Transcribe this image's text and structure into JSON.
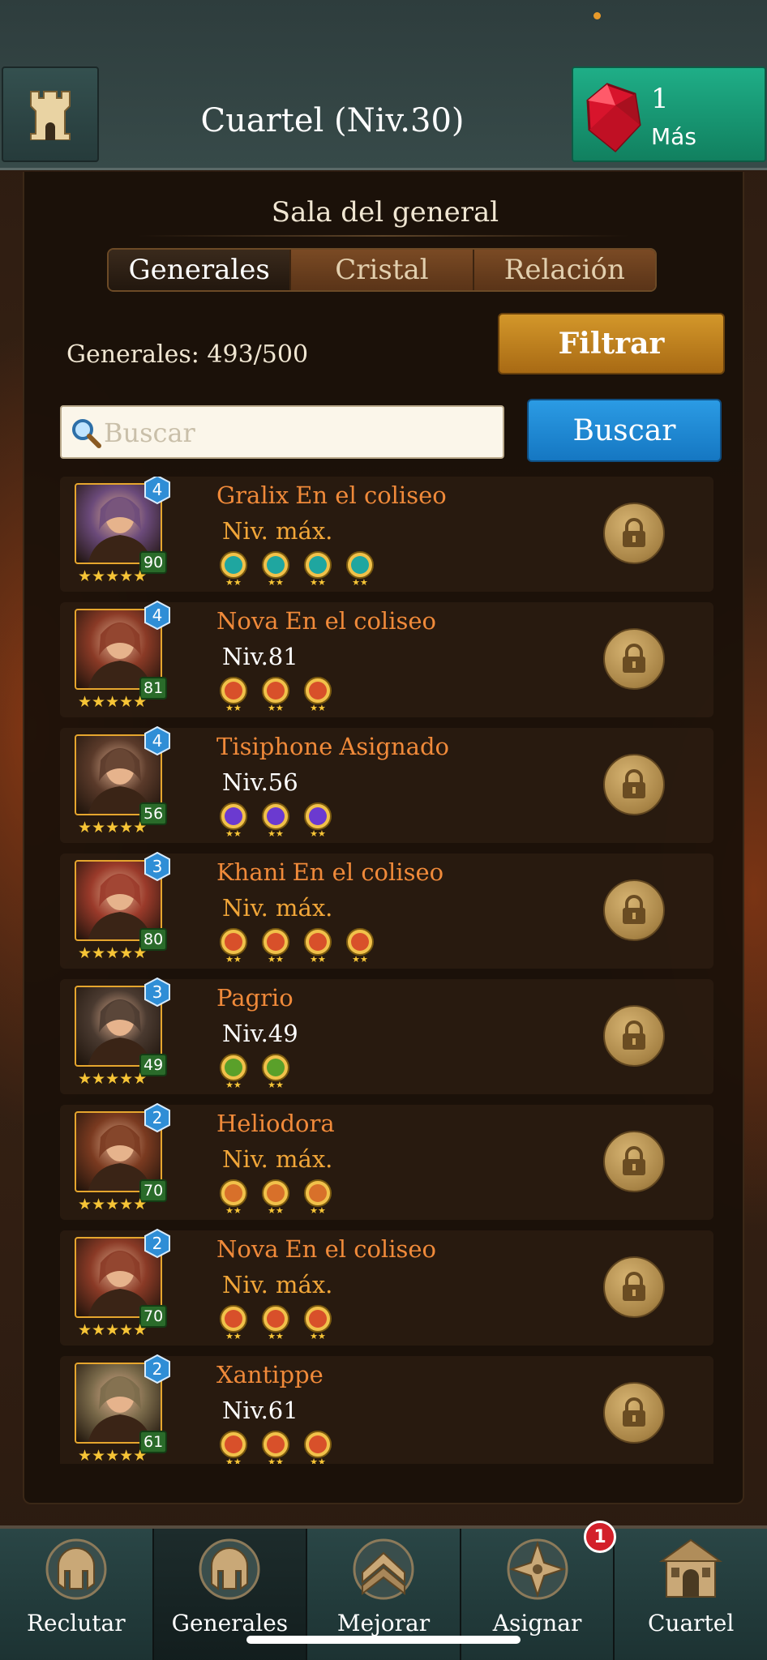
{
  "header": {
    "title": "Cuartel (Niv.30)",
    "gems": "1",
    "more_label": "Más"
  },
  "panel": {
    "subtitle": "Sala del general",
    "tabs": [
      {
        "label": "Generales",
        "active": true
      },
      {
        "label": "Cristal",
        "active": false
      },
      {
        "label": "Relación",
        "active": false
      }
    ],
    "count_label": "Generales: 493/500",
    "filter_label": "Filtrar",
    "search_placeholder": "Buscar",
    "search_button": "Buscar"
  },
  "generals": [
    {
      "name": "Gralix",
      "status": "En el coliseo",
      "level_text": "Niv. máx.",
      "level_badge": "90",
      "rank": "4",
      "stars": "★★★★★",
      "skill_color": "#1fa6a0",
      "skills": 4,
      "portrait": "#6b4a7a"
    },
    {
      "name": "Nova",
      "status": "En el coliseo",
      "level_text": "Niv.81",
      "level_badge": "81",
      "rank": "4",
      "stars": "★★★★★",
      "skill_color": "#d8502a",
      "skills": 3,
      "portrait": "#8a3a26"
    },
    {
      "name": "Tisiphone",
      "status": "Asignado",
      "level_text": "Niv.56",
      "level_badge": "56",
      "rank": "4",
      "stars": "★★★★★",
      "skill_color": "#6b3ad0",
      "skills": 3,
      "portrait": "#5a3a2a"
    },
    {
      "name": "Khani",
      "status": "En el coliseo",
      "level_text": "Niv. máx.",
      "level_badge": "80",
      "rank": "3",
      "stars": "★★★★★",
      "skill_color": "#d8502a",
      "skills": 4,
      "portrait": "#9a3a2a"
    },
    {
      "name": "Pagrio",
      "status": "",
      "level_text": "Niv.49",
      "level_badge": "49",
      "rank": "3",
      "stars": "★★★★★",
      "skill_color": "#5aa02a",
      "skills": 2,
      "portrait": "#4a3a30"
    },
    {
      "name": "Heliodora",
      "status": "",
      "level_text": "Niv. máx.",
      "level_badge": "70",
      "rank": "2",
      "stars": "★★★★★",
      "skill_color": "#d8702a",
      "skills": 3,
      "portrait": "#7a3a20"
    },
    {
      "name": "Nova",
      "status": "En el coliseo",
      "level_text": "Niv. máx.",
      "level_badge": "70",
      "rank": "2",
      "stars": "★★★★★",
      "skill_color": "#d8502a",
      "skills": 3,
      "portrait": "#8a3a26"
    },
    {
      "name": "Xantippe",
      "status": "",
      "level_text": "Niv.61",
      "level_badge": "61",
      "rank": "2",
      "stars": "★★★★★",
      "skill_color": "#d8502a",
      "skills": 3,
      "portrait": "#7a6a4a"
    }
  ],
  "nav": [
    {
      "label": "Reclutar",
      "icon": "helmet-icon",
      "active": false
    },
    {
      "label": "Generales",
      "icon": "helmet-icon",
      "active": true
    },
    {
      "label": "Mejorar",
      "icon": "chevron-rank-icon",
      "active": false
    },
    {
      "label": "Asignar",
      "icon": "compass-star-icon",
      "active": false
    },
    {
      "label": "Cuartel",
      "icon": "barracks-icon",
      "active": false
    }
  ],
  "notification_count": "1",
  "colors": {
    "gem_button": "#1fae87",
    "filter_button": "#d3972a",
    "search_button": "#2b9be4",
    "name_orange": "#f08a3a",
    "max_level": "#f1a639"
  }
}
